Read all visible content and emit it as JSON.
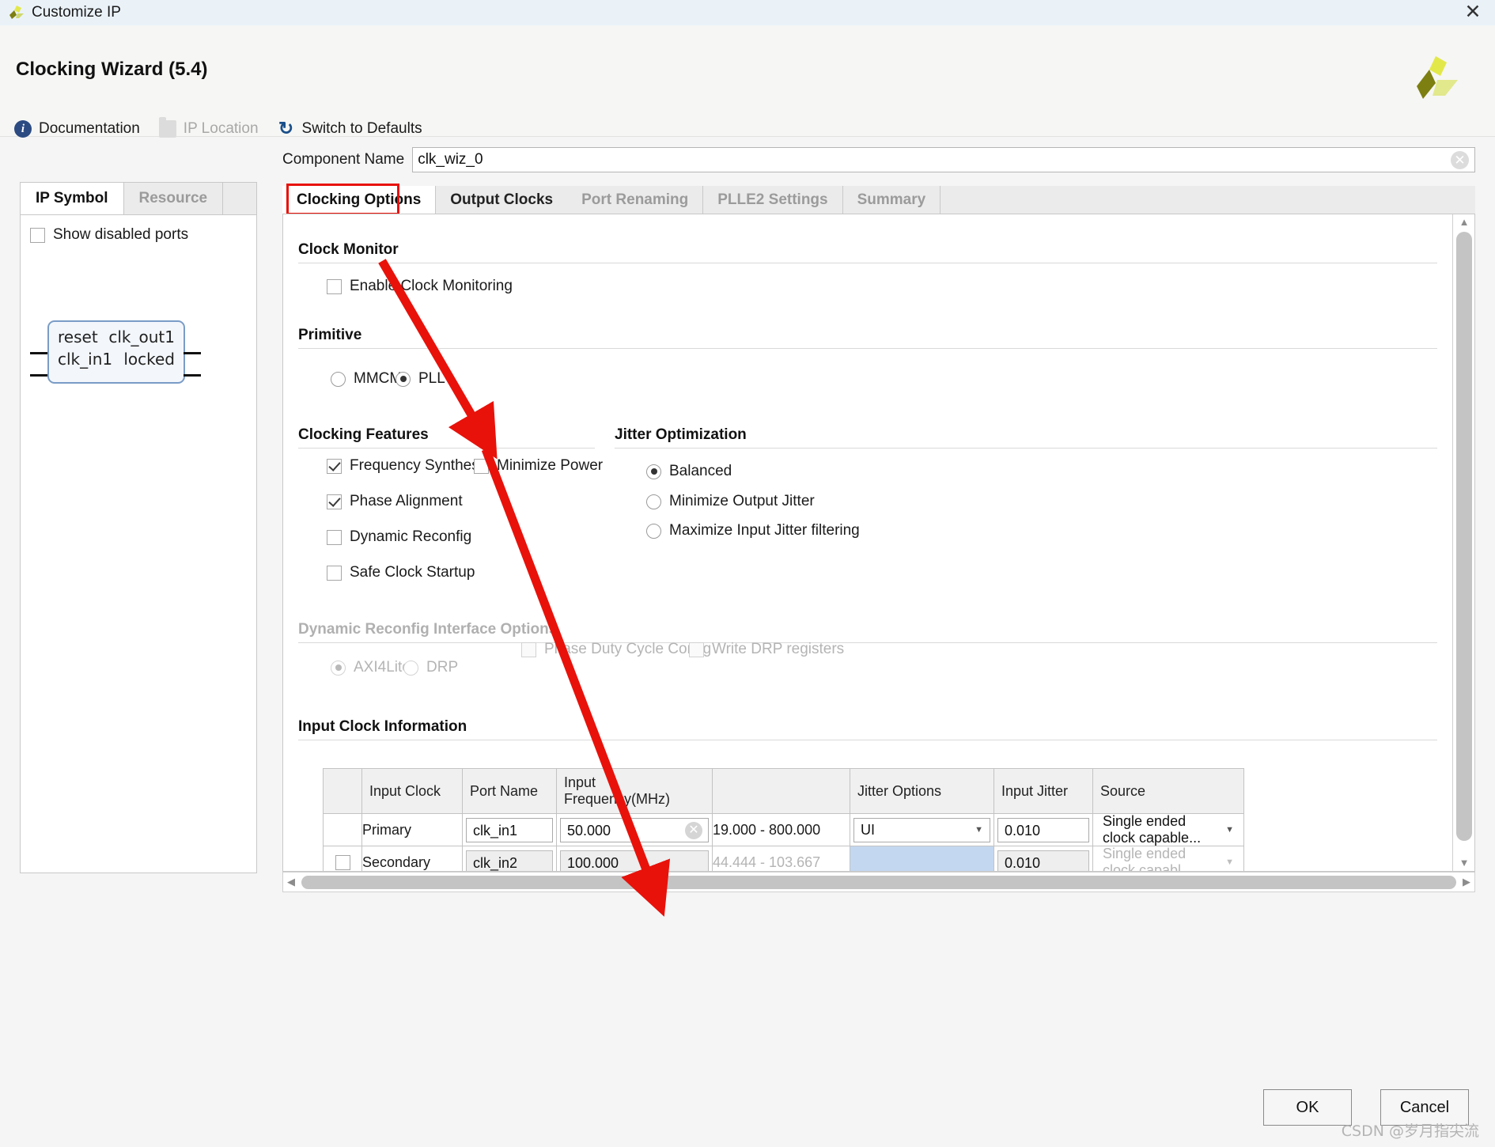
{
  "window": {
    "title": "Customize IP",
    "close_icon": "close-icon",
    "app_logo": "xilinx-logo"
  },
  "header": {
    "page_title": "Clocking Wizard (5.4)",
    "toolbar": [
      {
        "label": "Documentation",
        "icon": "info-icon",
        "disabled": false
      },
      {
        "label": "IP Location",
        "icon": "folder-icon",
        "disabled": true
      },
      {
        "label": "Switch to Defaults",
        "icon": "refresh-icon",
        "disabled": false
      }
    ]
  },
  "left_panel": {
    "tabs": [
      {
        "label": "IP Symbol",
        "active": true
      },
      {
        "label": "Resource",
        "active": false
      }
    ],
    "show_disabled_ports": {
      "label": "Show disabled ports",
      "checked": false
    },
    "symbol": {
      "inputs": [
        "reset",
        "clk_in1"
      ],
      "outputs": [
        "clk_out1",
        "locked"
      ]
    }
  },
  "component": {
    "label": "Component Name",
    "value": "clk_wiz_0",
    "clear_icon": "clear-icon"
  },
  "tabs": [
    {
      "label": "Clocking Options",
      "state": "active"
    },
    {
      "label": "Output Clocks",
      "state": "enabled"
    },
    {
      "label": "Port Renaming",
      "state": "disabled"
    },
    {
      "label": "PLLE2 Settings",
      "state": "disabled"
    },
    {
      "label": "Summary",
      "state": "disabled"
    }
  ],
  "sections": {
    "clock_monitor": {
      "title": "Clock Monitor",
      "enable_clock_monitoring": {
        "label": "Enable Clock Monitoring",
        "checked": false
      }
    },
    "primitive": {
      "title": "Primitive",
      "options": [
        {
          "label": "MMCM",
          "selected": false
        },
        {
          "label": "PLL",
          "selected": true
        }
      ]
    },
    "clocking_features": {
      "title": "Clocking Features",
      "items": [
        {
          "label": "Frequency Synthesis",
          "checked": true
        },
        {
          "label": "Minimize Power",
          "checked": false
        },
        {
          "label": "Phase Alignment",
          "checked": true
        },
        {
          "label": "Dynamic Reconfig",
          "checked": false
        },
        {
          "label": "Safe Clock Startup",
          "checked": false
        }
      ]
    },
    "jitter_optimization": {
      "title": "Jitter Optimization",
      "options": [
        {
          "label": "Balanced",
          "selected": true
        },
        {
          "label": "Minimize Output Jitter",
          "selected": false
        },
        {
          "label": "Maximize Input Jitter filtering",
          "selected": false
        }
      ]
    },
    "dynamic_reconfig": {
      "title": "Dynamic Reconfig Interface Options",
      "radios": [
        {
          "label": "AXI4Lite",
          "selected": true,
          "disabled": true
        },
        {
          "label": "DRP",
          "selected": false,
          "disabled": true
        }
      ],
      "checks": [
        {
          "label": "Phase Duty Cycle Config",
          "checked": false,
          "disabled": true
        },
        {
          "label": "Write DRP registers",
          "checked": false,
          "disabled": true
        }
      ]
    },
    "input_clock_information": {
      "title": "Input Clock Information",
      "columns": [
        "",
        "Input Clock",
        "Port Name",
        "Input Frequency(MHz)",
        "",
        "Jitter Options",
        "Input Jitter",
        "Source"
      ],
      "rows": [
        {
          "enabled_check": null,
          "input_clock": "Primary",
          "port_name": "clk_in1",
          "input_frequency": "50.000",
          "range": "19.000 - 800.000",
          "jitter_options": "UI",
          "input_jitter": "0.010",
          "source": "Single ended clock capable...",
          "disabled": false
        },
        {
          "enabled_check": false,
          "input_clock": "Secondary",
          "port_name": "clk_in2",
          "input_frequency": "100.000",
          "range": "44.444 - 103.667",
          "jitter_options": "",
          "input_jitter": "0.010",
          "source": "Single ended clock capabl...",
          "disabled": true
        }
      ]
    }
  },
  "footer": {
    "ok_label": "OK",
    "cancel_label": "Cancel",
    "watermark": "CSDN @岁月指尖流"
  },
  "colors": {
    "annotation_red": "#e8120b",
    "title_bar": "#eaf2f8",
    "selected_cell": "#c3d8f0"
  }
}
